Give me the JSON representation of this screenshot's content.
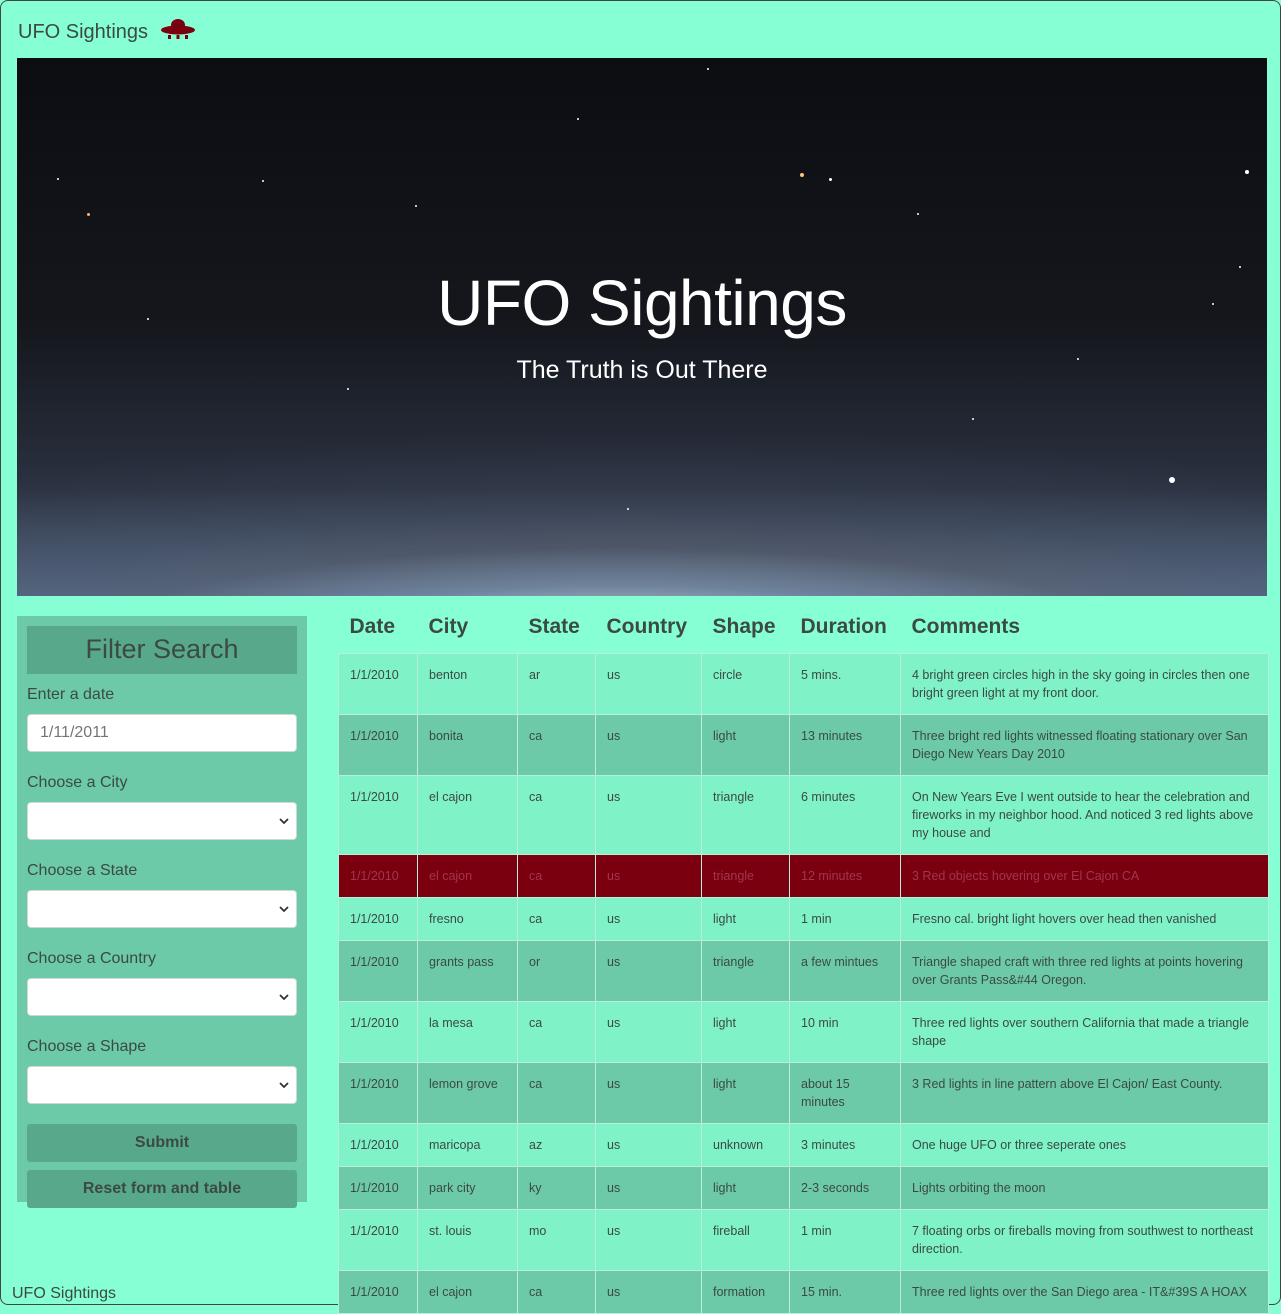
{
  "navbar": {
    "brand": "UFO Sightings"
  },
  "hero": {
    "title": "UFO Sightings",
    "subtitle": "The Truth is Out There"
  },
  "filter": {
    "title": "Filter Search",
    "date_label": "Enter a date",
    "date_placeholder": "1/11/2011",
    "city_label": "Choose a City",
    "state_label": "Choose a State",
    "country_label": "Choose a Country",
    "shape_label": "Choose a Shape",
    "submit_label": "Submit",
    "reset_label": "Reset form and table"
  },
  "table": {
    "headers": [
      "Date",
      "City",
      "State",
      "Country",
      "Shape",
      "Duration",
      "Comments"
    ],
    "rows": [
      [
        "1/1/2010",
        "benton",
        "ar",
        "us",
        "circle",
        "5 mins.",
        "4 bright green circles high in the sky going in circles then one bright green light at my front door."
      ],
      [
        "1/1/2010",
        "bonita",
        "ca",
        "us",
        "light",
        "13 minutes",
        "Three bright red lights witnessed floating stationary over San Diego New Years Day 2010"
      ],
      [
        "1/1/2010",
        "el cajon",
        "ca",
        "us",
        "triangle",
        "6 minutes",
        "On New Years Eve I went outside to hear the celebration and fireworks in my neighbor hood. And noticed 3 red lights above my house and"
      ],
      [
        "1/1/2010",
        "el cajon",
        "ca",
        "us",
        "triangle",
        "12 minutes",
        "3 Red objects hovering over El Cajon CA"
      ],
      [
        "1/1/2010",
        "fresno",
        "ca",
        "us",
        "light",
        "1 min",
        "Fresno cal. bright light hovers over head then vanished"
      ],
      [
        "1/1/2010",
        "grants pass",
        "or",
        "us",
        "triangle",
        "a few mintues",
        "Triangle shaped craft with three red lights at points hovering over Grants Pass&#44 Oregon."
      ],
      [
        "1/1/2010",
        "la mesa",
        "ca",
        "us",
        "light",
        "10 min",
        "Three red lights over southern California that made a triangle shape"
      ],
      [
        "1/1/2010",
        "lemon grove",
        "ca",
        "us",
        "light",
        "about 15 minutes",
        "3 Red lights in line pattern above El Cajon/ East County."
      ],
      [
        "1/1/2010",
        "maricopa",
        "az",
        "us",
        "unknown",
        "3 minutes",
        "One huge UFO or three seperate ones"
      ],
      [
        "1/1/2010",
        "park city",
        "ky",
        "us",
        "light",
        "2-3 seconds",
        "Lights orbiting the moon"
      ],
      [
        "1/1/2010",
        "st. louis",
        "mo",
        "us",
        "fireball",
        "1 min",
        "7 floating orbs or fireballs moving from southwest to northeast direction."
      ],
      [
        "1/1/2010",
        "el cajon",
        "ca",
        "us",
        "formation",
        "15 min.",
        "Three red lights over the San Diego area - IT&#39S A HOAX"
      ]
    ],
    "highlighted_row": 3
  },
  "footer": {
    "text": "UFO Sightings"
  },
  "colors": {
    "background": "#86ffd4",
    "panel": "#6ccaa8",
    "accent": "#58a98c",
    "highlight": "#7a0010"
  },
  "icons": {
    "brand_icon": "ufo-icon"
  }
}
